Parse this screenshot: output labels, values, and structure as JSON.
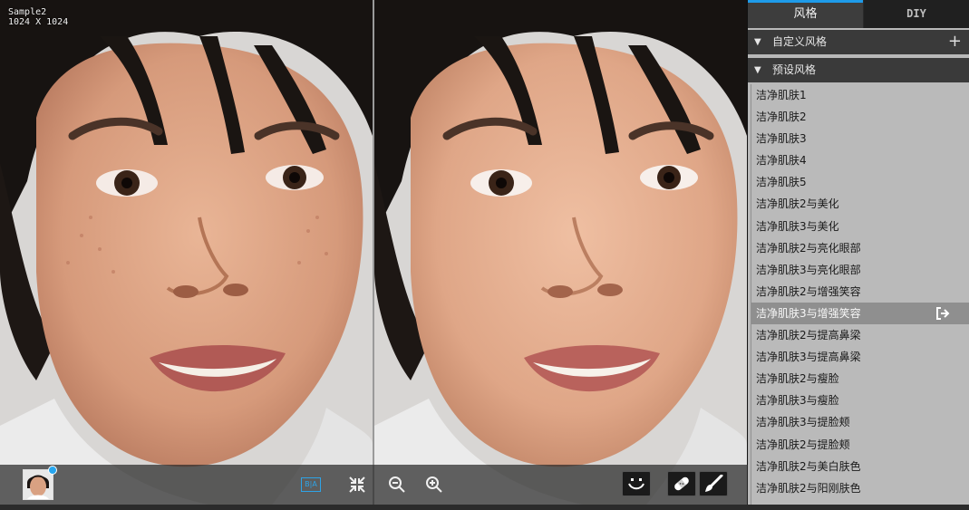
{
  "image_info": {
    "name": "Sample2",
    "size": "1024 X 1024"
  },
  "tabs": [
    {
      "label": "风格",
      "active": true
    },
    {
      "label": "DIY",
      "active": false
    }
  ],
  "sections": {
    "custom": {
      "label": "自定义风格",
      "add_icon": "plus-icon"
    },
    "preset": {
      "label": "预设风格"
    }
  },
  "presets": [
    "洁净肌肤1",
    "洁净肌肤2",
    "洁净肌肤3",
    "洁净肌肤4",
    "洁净肌肤5",
    "洁净肌肤2与美化",
    "洁净肌肤3与美化",
    "洁净肌肤2与亮化眼部",
    "洁净肌肤3与亮化眼部",
    "洁净肌肤2与增强笑容",
    "洁净肌肤3与增强笑容",
    "洁净肌肤2与提高鼻梁",
    "洁净肌肤3与提高鼻梁",
    "洁净肌肤2与瘦脸",
    "洁净肌肤3与瘦脸",
    "洁净肌肤3与提脸颊",
    "洁净肌肤2与提脸颊",
    "洁净肌肤2与美白肤色",
    "洁净肌肤2与阳刚肤色"
  ],
  "selected_preset_index": 10,
  "toolbar": {
    "before_after_label": "B|A",
    "icons": [
      "fit-screen-icon",
      "zoom-out-icon",
      "zoom-in-icon",
      "face-icon",
      "bandage-icon",
      "brush-icon"
    ]
  },
  "colors": {
    "accent": "#1e9be9",
    "panel_bg": "#b9b9b9",
    "selected_row": "#8f8f8f"
  }
}
